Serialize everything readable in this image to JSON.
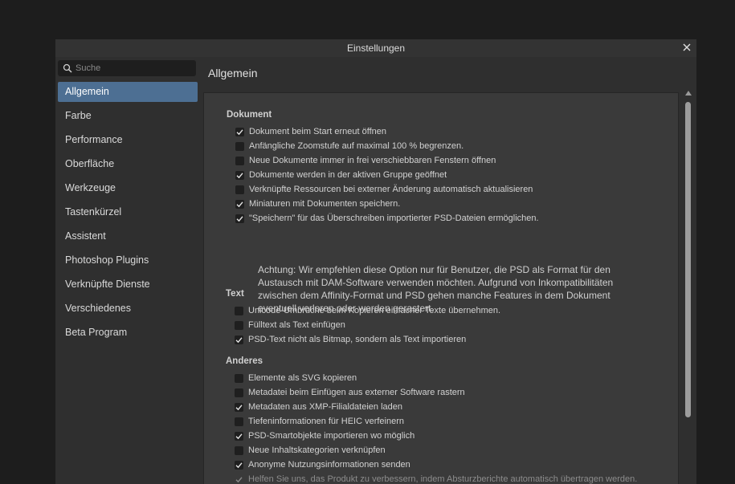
{
  "window": {
    "title": "Einstellungen"
  },
  "search": {
    "placeholder": "Suche"
  },
  "sidebar": {
    "items": [
      {
        "label": "Allgemein",
        "active": true
      },
      {
        "label": "Farbe"
      },
      {
        "label": "Performance"
      },
      {
        "label": "Oberfläche"
      },
      {
        "label": "Werkzeuge"
      },
      {
        "label": "Tastenkürzel"
      },
      {
        "label": "Assistent"
      },
      {
        "label": "Photoshop Plugins"
      },
      {
        "label": "Verknüpfte Dienste"
      },
      {
        "label": "Verschiedenes"
      },
      {
        "label": "Beta Program"
      }
    ]
  },
  "content": {
    "header": "Allgemein",
    "sections": {
      "dokument": {
        "title": "Dokument",
        "options": [
          {
            "label": "Dokument beim Start erneut öffnen",
            "checked": true
          },
          {
            "label": "Anfängliche Zoomstufe auf maximal 100 % begrenzen.",
            "checked": false
          },
          {
            "label": "Neue Dokumente immer in frei verschiebbaren Fenstern öffnen",
            "checked": false
          },
          {
            "label": "Dokumente werden in der aktiven Gruppe geöffnet",
            "checked": true
          },
          {
            "label": "Verknüpfte Ressourcen bei externer Änderung automatisch aktualisieren",
            "checked": false
          },
          {
            "label": "Miniaturen mit Dokumenten speichern.",
            "checked": true
          },
          {
            "label": "\"Speichern\" für das Überschreiben importierter PSD-Dateien ermöglichen.",
            "checked": true
          }
        ],
        "note": "Achtung: Wir empfehlen diese Option nur für Benutzer, die PSD als Format für den\nAustausch mit DAM-Software verwenden möchten. Aufgrund von Inkompatibilitäten\nzwischen dem Affinity-Format und PSD gehen manche Features in dem Dokument\neventuell verloren oder werden gerastert."
      },
      "text": {
        "title": "Text",
        "options": [
          {
            "label": "Unicode-Umbrüche beim Kopieren einfacher Texte übernehmen.",
            "checked": false
          },
          {
            "label": "Fülltext als Text einfügen",
            "checked": false
          },
          {
            "label": "PSD-Text nicht als Bitmap, sondern als Text importieren",
            "checked": true
          }
        ]
      },
      "anderes": {
        "title": "Anderes",
        "options": [
          {
            "label": "Elemente als SVG kopieren",
            "checked": false
          },
          {
            "label": "Metadatei beim Einfügen aus externer Software rastern",
            "checked": false
          },
          {
            "label": "Metadaten aus XMP-Filialdateien laden",
            "checked": true
          },
          {
            "label": "Tiefeninformationen für HEIC verfeinern",
            "checked": false
          },
          {
            "label": "PSD-Smartobjekte importieren wo möglich",
            "checked": true
          },
          {
            "label": "Neue Inhaltskategorien verknüpfen",
            "checked": false
          },
          {
            "label": "Anonyme Nutzungsinformationen senden",
            "checked": true
          },
          {
            "label": "Helfen Sie uns, das Produkt zu verbessern, indem Absturzberichte automatisch übertragen werden.",
            "checked": true,
            "disabled": true
          }
        ]
      }
    }
  },
  "icons": {
    "search": "search-icon",
    "close": "close-icon",
    "check": "checkmark-icon",
    "scroll_up": "chevron-up-icon"
  },
  "colors": {
    "background": "#1d1d1d",
    "window": "#2f2f2f",
    "panel": "#3a3a3a",
    "accent": "#4d6f93"
  }
}
